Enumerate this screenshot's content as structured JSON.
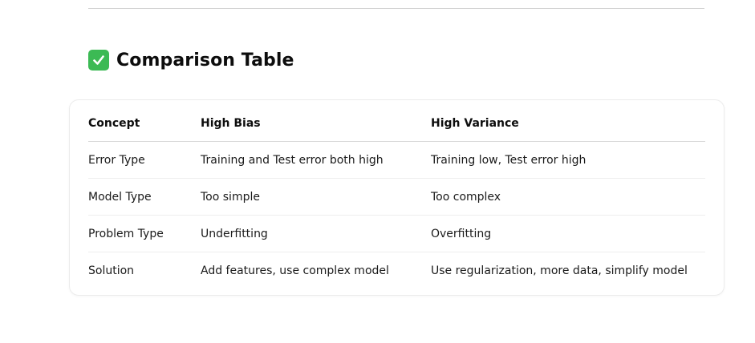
{
  "heading": {
    "icon": "check-mark-button-icon",
    "text": "Comparison Table"
  },
  "table": {
    "headers": [
      "Concept",
      "High Bias",
      "High Variance"
    ],
    "rows": [
      [
        "Error Type",
        "Training and Test error both high",
        "Training low, Test error high"
      ],
      [
        "Model Type",
        "Too simple",
        "Too complex"
      ],
      [
        "Problem Type",
        "Underfitting",
        "Overfitting"
      ],
      [
        "Solution",
        "Add features, use complex model",
        "Use regularization, more data, simplify model"
      ]
    ]
  },
  "colors": {
    "check_icon": "#3cba54",
    "text": "#0d0d0d",
    "divider": "#cfcfcf"
  }
}
